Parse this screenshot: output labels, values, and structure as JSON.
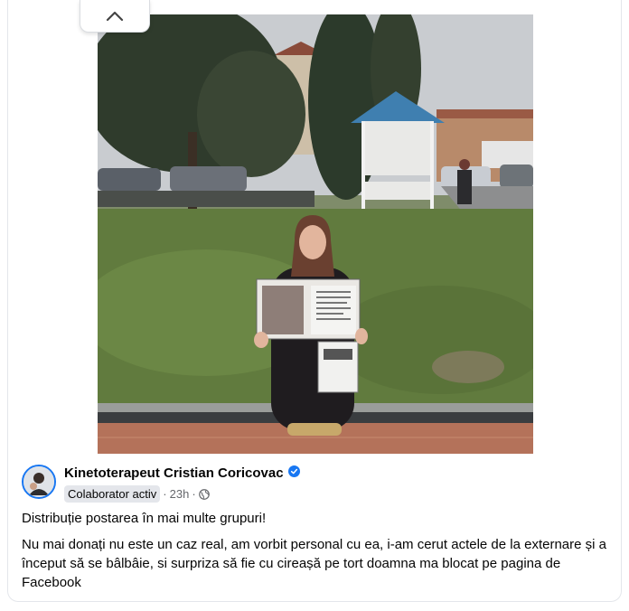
{
  "post": {
    "author": "Kinetoterapeut Cristian Coricovac",
    "badge": "Colaborator activ",
    "time": "23h",
    "separator": "·",
    "text_line1": "Distribuție postarea în mai multe grupuri!",
    "text_body": "Nu mai donați nu este un caz real, am vorbit personal cu ea, i-am cerut actele de la externare și a început să se bâlbâie, si surpriza să fie cu cireașă pe tort doamna ma blocat pe pagina de Facebook"
  },
  "icons": {
    "collapse": "chevron-up-icon",
    "verified": "verified-badge-icon",
    "audience": "globe-icon"
  },
  "colors": {
    "accent": "#1877f2",
    "secondary_text": "#65676b",
    "badge_bg": "#e4e6eb"
  }
}
